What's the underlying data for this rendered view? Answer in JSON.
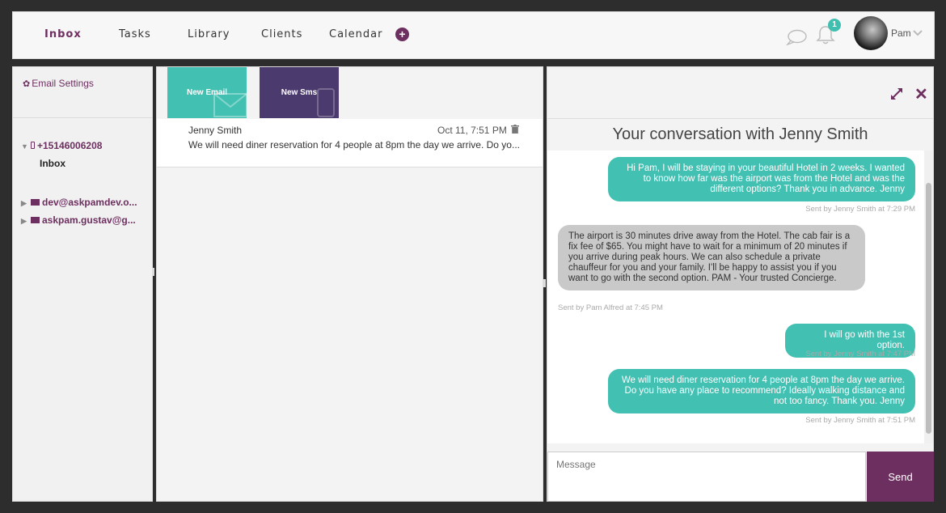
{
  "nav": {
    "items": [
      {
        "label": "Inbox",
        "active": true
      },
      {
        "label": "Tasks",
        "active": false
      },
      {
        "label": "Library",
        "active": false
      },
      {
        "label": "Clients",
        "active": false
      },
      {
        "label": "Calendar",
        "active": false
      }
    ],
    "add_icon": "+",
    "notification_count": "1",
    "user_name": "Pam",
    "user_menu_icon": "chevron-down-icon"
  },
  "sidebar": {
    "settings_label": "Email Settings",
    "accounts": [
      {
        "label": "+15146006208",
        "type": "phone",
        "expanded": true
      },
      {
        "label": "dev@askpamdev.o...",
        "type": "email",
        "expanded": false
      },
      {
        "label": "askpam.gustav@g...",
        "type": "email",
        "expanded": false
      }
    ],
    "inbox_label": "Inbox"
  },
  "compose": {
    "new_email_label": "New Email",
    "new_sms_label": "New Sms"
  },
  "message_list": [
    {
      "from": "Jenny Smith",
      "date": "Oct 11, 7:51 PM",
      "preview": "We will need diner reservation for 4 people at 8pm the day we arrive. Do yo..."
    }
  ],
  "conversation": {
    "title": "Your conversation with Jenny Smith",
    "messages": [
      {
        "direction": "out",
        "text": "Hi Pam, I will be staying in your beautiful Hotel in 2 weeks. I wanted to know how far was the airport was from the Hotel and was the different options? Thank you in advance. Jenny",
        "meta": "Sent by Jenny Smith at 7:29 PM"
      },
      {
        "direction": "in",
        "text": "The airport is 30 minutes drive away from the Hotel. The cab fair is a fix fee of $65. You might have to wait for a minimum of 20 minutes if you arrive during peak hours. We can also schedule a private chauffeur for you and your family. I'll be happy to assist you if you want to go with the second option. PAM - Your trusted Concierge.",
        "meta": "Sent by Pam Alfred at 7:45 PM"
      },
      {
        "direction": "out",
        "text": "I will go with the 1st option.",
        "meta": "Sent by Jenny Smith at 7:47 PM"
      },
      {
        "direction": "out",
        "text": "We will need diner reservation for 4 people at 8pm the day we arrive. Do you have any place to recommend? Ideally walking distance and not too fancy. Thank you. Jenny",
        "meta": "Sent by Jenny Smith at 7:51 PM"
      }
    ],
    "input_placeholder": "Message",
    "send_label": "Send"
  },
  "colors": {
    "brand": "#6d2f5f",
    "accent": "#42c0b2",
    "sms": "#4b3a6e"
  }
}
